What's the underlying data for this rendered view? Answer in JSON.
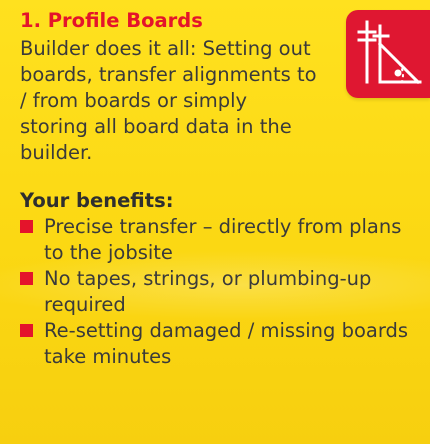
{
  "card": {
    "title": "1. Profile Boards",
    "intro": "Builder does it all: Setting out boards, transfer alignments to / from boards or simply storing all board data in the builder.",
    "benefits_heading": "Your benefits:",
    "benefits": [
      "Precise transfer – directly from plans to the jobsite",
      "No tapes, strings, or plumbing-up required",
      "Re-setting damaged / missing boards take minutes"
    ],
    "icon_name": "profile-boards-icon"
  },
  "colors": {
    "background": "#fbd813",
    "accent": "#e4142b",
    "text": "#3a3a3a"
  }
}
